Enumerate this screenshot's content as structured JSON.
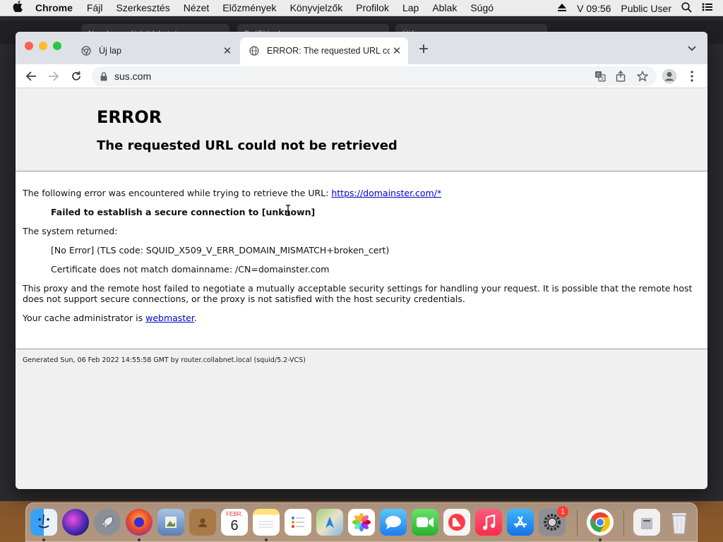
{
  "menubar": {
    "app_name": "Chrome",
    "items": [
      "Fájl",
      "Szerkesztés",
      "Nézet",
      "Előzmények",
      "Könyvjelzők",
      "Profilok",
      "Lap",
      "Ablak",
      "Súgó"
    ],
    "clock": "V 09:56",
    "user": "Public User"
  },
  "background_window": {
    "tabs": [
      "Nem kapcsolódott lehetséges",
      "Beállítások",
      "Új lap"
    ]
  },
  "tabs": [
    {
      "title": "Új lap",
      "icon": "chrome-icon"
    },
    {
      "title": "ERROR: The requested URL could not be retrieved",
      "icon": "globe-icon"
    }
  ],
  "toolbar": {
    "url": "sus.com"
  },
  "page": {
    "heading": "ERROR",
    "subheading": "The requested URL could not be retrieved",
    "intro": "The following error was encountered while trying to retrieve the URL: ",
    "intro_link": "https://domainster.com/*",
    "failure": "Failed to establish a secure connection to [unknown]",
    "system_returned": "The system returned:",
    "tls_error": "[No Error] (TLS code: SQUID_X509_V_ERR_DOMAIN_MISMATCH+broken_cert)",
    "cert_error": "Certificate does not match domainname: /CN=domainster.com",
    "explanation": "This proxy and the remote host failed to negotiate a mutually acceptable security settings for handling your request. It is possible that the remote host does not support secure connections, or the proxy is not satisfied with the host security credentials.",
    "admin_prefix": "Your cache administrator is ",
    "admin_link": "webmaster",
    "admin_suffix": ".",
    "footer": "Generated Sun, 06 Feb 2022 14:55:58 GMT by router.collabnet.local (squid/5.2-VCS)"
  },
  "dock": {
    "calendar_month": "FEBR.",
    "calendar_day": "6",
    "system_preferences_badge": "1"
  },
  "colors": {
    "link": "#0000cc",
    "tab_bar": "#dee1e6",
    "page_background": "#f0f0f0"
  }
}
